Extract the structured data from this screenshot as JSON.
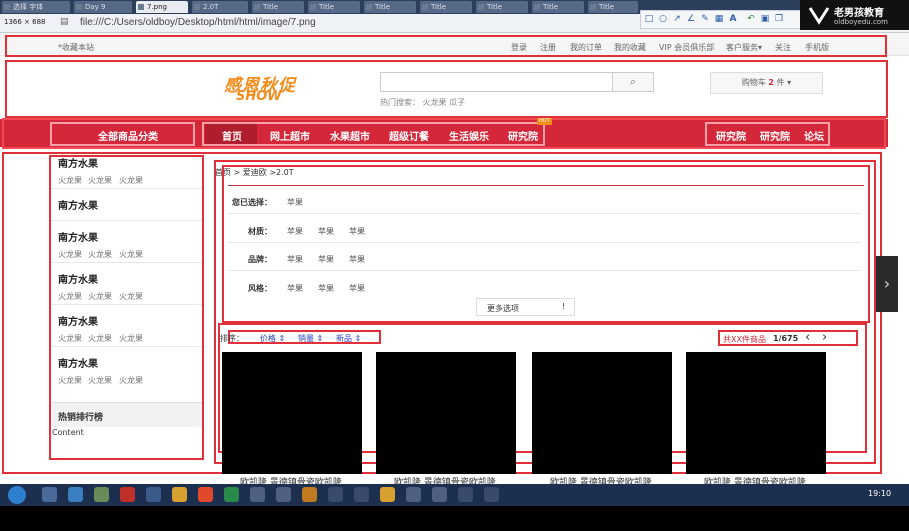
{
  "browser": {
    "tabs": [
      "选择 字体",
      "Day 9",
      "7.png",
      "2.0T",
      "Title",
      "Title",
      "Title",
      "Title",
      "Title",
      "Title",
      "Title"
    ],
    "url": "file:///C:/Users/oldboy/Desktop/html/html/image/7.png",
    "size_badge": "1366 × 688"
  },
  "watermark": {
    "logo_text": "老男孩教育",
    "site": "oldboyedu.com"
  },
  "topbar": {
    "bookmark": "*收藏本站",
    "links": [
      "登录",
      "注册",
      "我的订单",
      "我的收藏",
      "VIP 会员俱乐部",
      "客户服务▾",
      "关注",
      "手机版"
    ]
  },
  "header": {
    "brand_line1": "感恩秋促",
    "brand_line2": "SHOW",
    "search_placeholder": "",
    "search_icon": "search-icon",
    "hot_search": "热门搜索：  火龙果   瓜子",
    "cart_label": "购物车",
    "cart_count": "2",
    "cart_unit": "件 ▾"
  },
  "nav": {
    "all_categories": "全部商品分类",
    "items": [
      "首页",
      "网上超市",
      "水果超市",
      "超级订餐",
      "生活娱乐",
      "研究院"
    ],
    "hot_badge": "HOT",
    "right_items": [
      "研究院",
      "研究院",
      "论坛"
    ]
  },
  "sidebar": {
    "categories": [
      {
        "title": "南方水果",
        "subs": [
          "火龙果",
          "火龙果",
          "火龙果"
        ]
      },
      {
        "title": "南方水果",
        "subs": []
      },
      {
        "title": "南方水果",
        "subs": [
          "火龙果",
          "火龙果",
          "火龙果"
        ]
      },
      {
        "title": "南方水果",
        "subs": [
          "火龙果",
          "火龙果",
          "火龙果"
        ]
      },
      {
        "title": "南方水果",
        "subs": [
          "火龙果",
          "火龙果",
          "火龙果"
        ]
      },
      {
        "title": "南方水果",
        "subs": [
          "火龙果",
          "火龙果",
          "火龙果"
        ]
      }
    ],
    "ranking_title": "热销排行榜",
    "ranking_content": "Content"
  },
  "main": {
    "breadcrumb": "首页 > 爱迪欧 >2.0T",
    "filters": [
      {
        "label": "您已选择：",
        "values": [
          "苹果"
        ]
      },
      {
        "label": "材质：",
        "values": [
          "苹果",
          "苹果",
          "苹果"
        ]
      },
      {
        "label": "品牌：",
        "values": [
          "苹果",
          "苹果",
          "苹果"
        ]
      },
      {
        "label": "风格：",
        "values": [
          "苹果",
          "苹果",
          "苹果"
        ]
      }
    ],
    "more_options": "更多选项",
    "more_icon": "!",
    "sort": {
      "label": "排序：",
      "options": [
        "价格 ⇕",
        "销量 ⇕",
        "新品 ⇕"
      ],
      "total_prefix": "共",
      "total_text": "XX件商品",
      "page": "1/675",
      "prev": "‹",
      "next": "›"
    },
    "products": [
      {
        "caption": "欧凯隆 景德镇骨瓷欧凯隆"
      },
      {
        "caption": "欧凯隆 景德镇骨瓷欧凯隆"
      },
      {
        "caption": "欧凯隆 景德镇骨瓷欧凯隆"
      },
      {
        "caption": "欧凯隆 景德镇骨瓷欧凯隆"
      }
    ]
  },
  "taskbar": {
    "clock": "19:10"
  },
  "colors": {
    "accent_red": "#d4283a",
    "outline_red": "#e0303a",
    "brand_orange": "#f28c1a"
  }
}
